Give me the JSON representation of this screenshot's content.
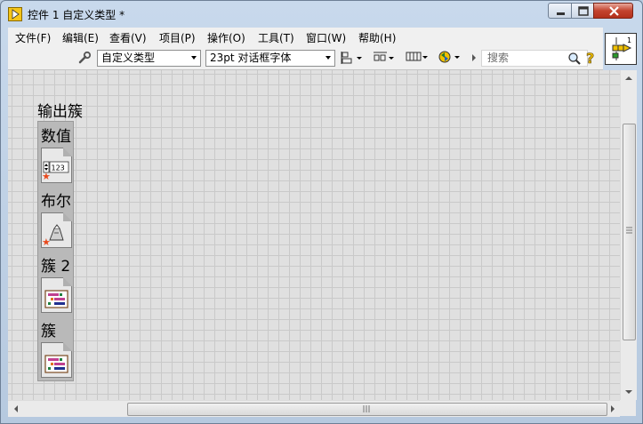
{
  "window": {
    "title": "控件 1 自定义类型 *"
  },
  "menu": [
    "文件(F)",
    "编辑(E)",
    "查看(V)",
    "项目(P)",
    "操作(O)",
    "工具(T)",
    "窗口(W)",
    "帮助(H)"
  ],
  "toolbar": {
    "control_type": "自定义类型",
    "font": "23pt 对话框字体",
    "search_placeholder": "搜索"
  },
  "cluster": {
    "label": "输出簇",
    "elements": [
      {
        "label": "数值",
        "icon": "numeric-control-icon"
      },
      {
        "label": "布尔",
        "icon": "boolean-control-icon"
      },
      {
        "label": "簇 2",
        "icon": "cluster-control-icon"
      },
      {
        "label": "簇",
        "icon": "cluster-control-icon"
      }
    ]
  },
  "colors": {
    "canvas": "#e0e0e0",
    "grid": "#c9c9c9",
    "close_button": "#c3432e",
    "accent_star": "#e8491d"
  }
}
